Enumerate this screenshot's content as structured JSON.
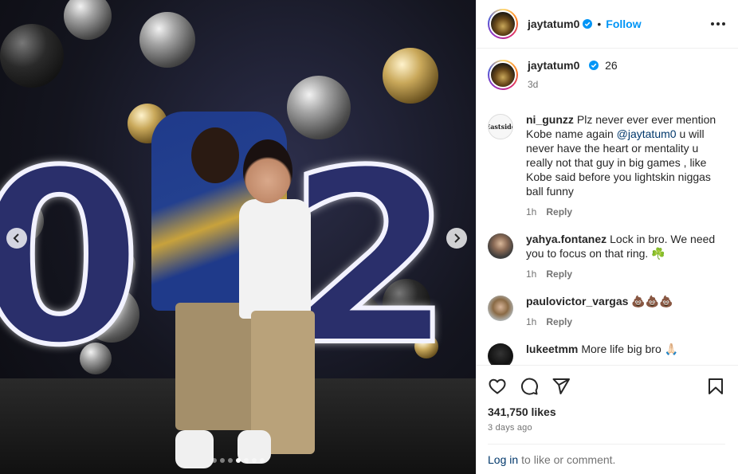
{
  "post": {
    "author": {
      "username": "jaytatum0",
      "verified": true,
      "follow_separator": "•",
      "follow_label": "Follow"
    },
    "media": {
      "slide_count": 7,
      "active_slide": 4,
      "digits": [
        "0",
        "2"
      ]
    },
    "caption": {
      "username": "jaytatum0",
      "text": "26",
      "time": "3d"
    },
    "comments": [
      {
        "username": "ni_gunzz",
        "avatar_text": "Eastside",
        "text_before": "Plz never ever ever mention Kobe name again ",
        "mention": "@jaytatum0",
        "text_after": " u will never have the heart or mentality u really not that guy in big games , like Kobe said before you lightskin niggas ball funny",
        "time": "1h",
        "reply_label": "Reply"
      },
      {
        "username": "yahya.fontanez",
        "text": "Lock in bro. We need you to focus on that ring. ☘️",
        "time": "1h",
        "reply_label": "Reply"
      },
      {
        "username": "paulovictor_vargas",
        "text": "💩💩💩",
        "time": "1h",
        "reply_label": "Reply"
      },
      {
        "username": "lukeetmm",
        "text": "More life big bro 🙏🏻"
      }
    ],
    "likes": "341,750 likes",
    "date": "3 days ago",
    "login": {
      "link_label": "Log in",
      "text": "to like or comment."
    }
  },
  "colors": {
    "link": "#0095f6",
    "mention": "#00376b",
    "muted": "#737373",
    "border": "#efefef"
  }
}
